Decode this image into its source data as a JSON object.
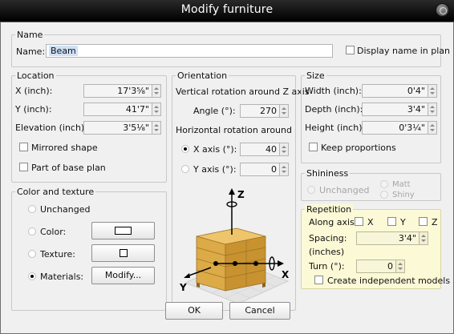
{
  "window": {
    "title": "Modify furniture"
  },
  "name_group": {
    "legend": "Name",
    "label": "Name:",
    "value": "Beam",
    "display_in_plan_label": "Display name in plan",
    "display_in_plan_checked": false
  },
  "location": {
    "legend": "Location",
    "x_label": "X (inch):",
    "x_value": "17'3⅝\"",
    "y_label": "Y (inch):",
    "y_value": "41'7\"",
    "elevation_label": "Elevation (inch):",
    "elevation_value": "3'5⅛\"",
    "mirrored_label": "Mirrored shape",
    "mirrored_checked": false,
    "base_plan_label": "Part of base plan",
    "base_plan_checked": false
  },
  "orientation": {
    "legend": "Orientation",
    "vertical_label": "Vertical rotation around Z axis",
    "angle_label": "Angle (°):",
    "angle_value": "270",
    "horizontal_label": "Horizontal rotation around",
    "x_axis_label": "X axis (°):",
    "x_axis_value": "40",
    "y_axis_label": "Y axis (°):",
    "y_axis_value": "0",
    "selected_axis": "X axis",
    "axis_labels": {
      "z": "Z",
      "x": "X",
      "y": "Y"
    }
  },
  "color_texture": {
    "legend": "Color and texture",
    "unchanged_label": "Unchanged",
    "color_label": "Color:",
    "texture_label": "Texture:",
    "materials_label": "Materials:",
    "materials_button": "Modify...",
    "selected": "Materials"
  },
  "size": {
    "legend": "Size",
    "width_label": "Width (inch):",
    "width_value": "0'4\"",
    "depth_label": "Depth (inch):",
    "depth_value": "3'4\"",
    "height_label": "Height (inch):",
    "height_value": "0'3¼\"",
    "keep_proportions_label": "Keep proportions",
    "keep_proportions_checked": false
  },
  "shininess": {
    "legend": "Shininess",
    "unchanged_label": "Unchanged",
    "matt_label": "Matt",
    "shiny_label": "Shiny"
  },
  "repetition": {
    "legend": "Repetition",
    "along_axis_label": "Along axis:",
    "x_label": "X",
    "y_label": "Y",
    "z_label": "Z",
    "spacing_label": "Spacing:",
    "spacing_unit": "(inches)",
    "spacing_value": "3'4\"",
    "turn_label": "Turn (°):",
    "turn_value": "0",
    "independent_label": "Create independent models"
  },
  "buttons": {
    "ok": "OK",
    "cancel": "Cancel"
  },
  "colors": {
    "title_bg": "#000000",
    "dialog_bg": "#f0f0f0",
    "repetition_bg": "#fbf9d6",
    "dresser_wood": "#d7a94a"
  },
  "icons": {
    "close": "close-icon",
    "rotate": "rotation-arrow-icon",
    "furniture_preview": "dresser-preview-icon"
  }
}
